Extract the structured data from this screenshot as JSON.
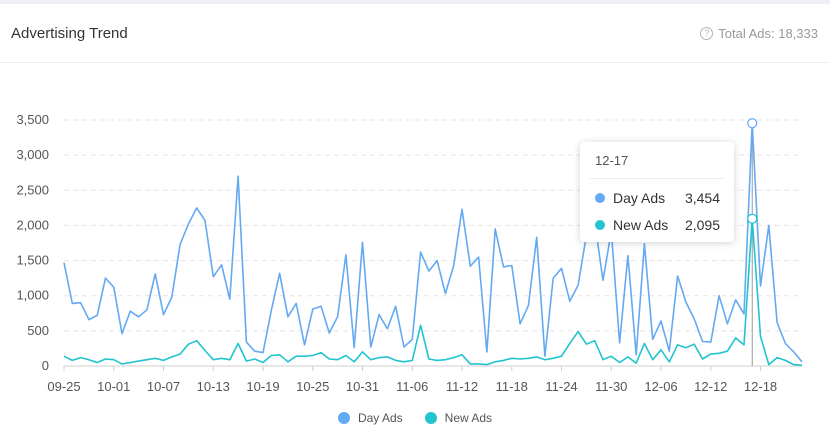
{
  "header": {
    "title": "Advertising Trend",
    "total_label": "Total Ads: 18,333"
  },
  "colors": {
    "day_ads": "#64a9f3",
    "new_ads": "#21c4cf",
    "grid": "#e4e4e4",
    "axis_text": "#555555"
  },
  "tooltip": {
    "date": "12-17",
    "rows": [
      {
        "name": "Day Ads",
        "value": "3,454"
      },
      {
        "name": "New Ads",
        "value": "2,095"
      }
    ]
  },
  "legend": [
    {
      "name": "Day Ads"
    },
    {
      "name": "New Ads"
    }
  ],
  "chart_data": {
    "type": "line",
    "title": "Advertising Trend",
    "x_start": "09-25",
    "x_end": "12-22",
    "x_ticks": [
      "09-25",
      "10-01",
      "10-07",
      "10-13",
      "10-19",
      "10-25",
      "10-31",
      "11-06",
      "11-12",
      "11-18",
      "11-24",
      "11-30",
      "12-06",
      "12-12",
      "12-18"
    ],
    "y_ticks": [
      "0",
      "500",
      "1,000",
      "1,500",
      "2,000",
      "2,500",
      "3,000",
      "3,500"
    ],
    "ylim": [
      0,
      3500
    ],
    "grid": true,
    "legend_position": "bottom",
    "highlight_x": "12-17",
    "series": [
      {
        "name": "Day Ads",
        "values": [
          1470,
          890,
          900,
          660,
          720,
          1250,
          1120,
          460,
          780,
          700,
          800,
          1310,
          730,
          980,
          1730,
          2020,
          2250,
          2070,
          1270,
          1440,
          950,
          2700,
          340,
          210,
          190,
          790,
          1320,
          700,
          890,
          300,
          810,
          850,
          470,
          700,
          1580,
          260,
          1760,
          270,
          730,
          530,
          850,
          270,
          380,
          1620,
          1350,
          1500,
          1030,
          1430,
          2230,
          1420,
          1550,
          200,
          1950,
          1410,
          1430,
          600,
          860,
          1830,
          140,
          1250,
          1390,
          920,
          1150,
          1860,
          2050,
          1220,
          1920,
          330,
          1570,
          160,
          1740,
          380,
          640,
          210,
          1280,
          910,
          670,
          350,
          340,
          1000,
          600,
          940,
          740,
          3454,
          1140,
          2000,
          620,
          320,
          200,
          60
        ]
      },
      {
        "name": "New Ads",
        "values": [
          140,
          80,
          120,
          90,
          50,
          100,
          90,
          30,
          50,
          70,
          90,
          110,
          80,
          130,
          170,
          310,
          360,
          220,
          90,
          110,
          90,
          320,
          70,
          100,
          50,
          150,
          160,
          60,
          140,
          140,
          150,
          190,
          100,
          90,
          150,
          60,
          200,
          90,
          120,
          130,
          80,
          60,
          80,
          580,
          100,
          80,
          90,
          120,
          160,
          30,
          30,
          20,
          60,
          80,
          110,
          100,
          110,
          130,
          90,
          110,
          140,
          320,
          490,
          310,
          360,
          90,
          140,
          50,
          130,
          40,
          320,
          90,
          230,
          60,
          300,
          260,
          310,
          100,
          170,
          180,
          210,
          400,
          300,
          2095,
          420,
          20,
          120,
          80,
          20,
          10
        ]
      }
    ]
  }
}
